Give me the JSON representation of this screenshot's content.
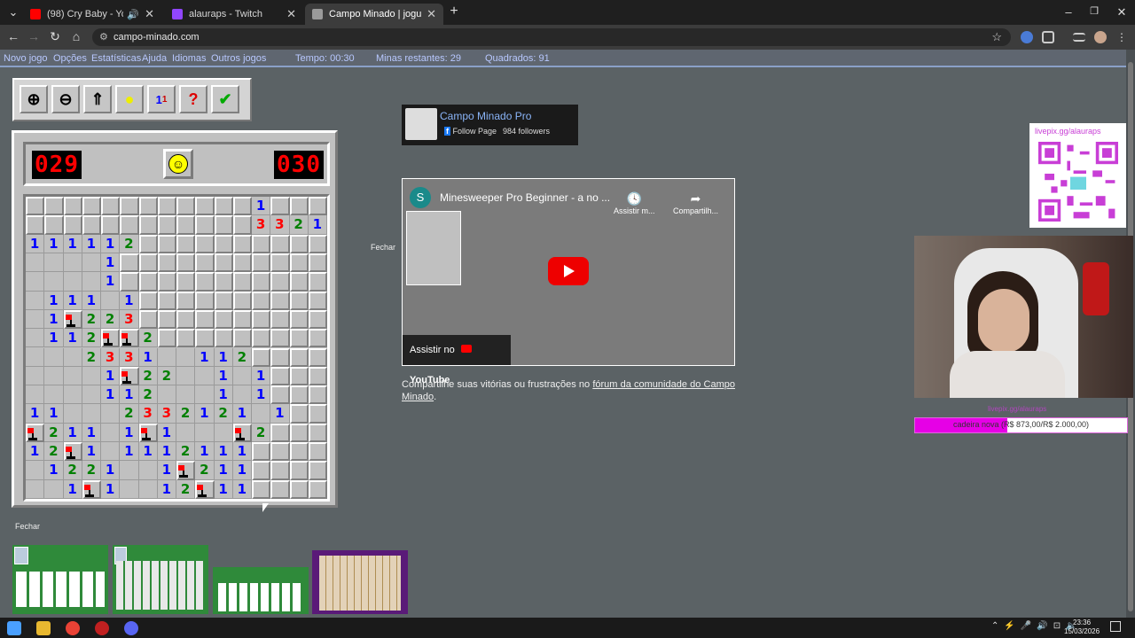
{
  "browser": {
    "tabs": [
      {
        "title": "(98) Cry Baby - YouTube",
        "color": "#ff0000",
        "audio": true
      },
      {
        "title": "alauraps - Twitch",
        "color": "#9146ff"
      },
      {
        "title": "Campo Minado | jogue online",
        "color": "#888888",
        "active": true
      }
    ],
    "url": "campo-minado.com"
  },
  "menu": {
    "items": [
      "Novo jogo",
      "Opções",
      "Estatísticas",
      "Ajuda",
      "Idiomas",
      "Outros jogos"
    ],
    "time": "Tempo: 00:30",
    "mines_left": "Minas restantes: 29",
    "squares": "Quadrados: 91"
  },
  "toolbox": [
    "zoom-in",
    "zoom-out",
    "scroll-up",
    "hint",
    "numbers",
    "help",
    "check"
  ],
  "game": {
    "mines_counter": "029",
    "timer": "030",
    "rows": [
      "CCCCCCCCCCCC1CCC",
      "CCCCCCCCCCCC3321",
      "111112CCCCCCCCCC",
      "....1CCCCCCCCCCC",
      "....1CCCCCCCCCCC",
      ".111.1CCCCCCCCCC",
      ".1F223CCCCCCCCCC",
      ".112FF2CCCCCCCCC",
      "...2331..112CCCC",
      "....1F22..1.1CCC",
      "....112...1.1CCC",
      "11...2332121.1CC",
      "F211.1F1...F2CCC",
      "12F1.1112111CCCC",
      ".1221..1F211CCCC",
      "..1F1..12F11CCCC"
    ]
  },
  "facebook": {
    "page_name": "Campo Minado Pro",
    "follow_label": "Follow Page",
    "followers": "984 followers"
  },
  "close_label": "Fechar",
  "video": {
    "avatar_letter": "S",
    "title": "Minesweeper Pro Beginner - a no ...",
    "watch_later": "Assistir m...",
    "share": "Compartilh...",
    "watch_on": "Assistir no",
    "youtube": "YouTube"
  },
  "share_text": {
    "prefix": "Compartilhe suas vitórias ou frustrações no ",
    "link": "fórum da comunidade do Campo Minado",
    "suffix": "."
  },
  "stream": {
    "qr_label": "livepix.gg/alauraps",
    "goal_title": "livepix.gg/alauraps",
    "goal_text": "cadeira nova (R$ 873,00/R$ 2.000,00)",
    "goal_fraction": 0.4365
  },
  "taskbar": {
    "time": "23:36",
    "date": "15/03/2026"
  }
}
